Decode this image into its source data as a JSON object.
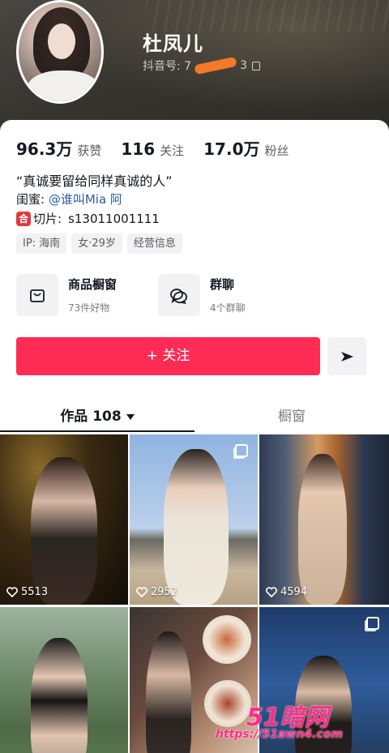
{
  "profile": {
    "name": "杜凤儿",
    "uid_label": "抖音号: 7",
    "uid_tail": "3"
  },
  "stats": [
    {
      "value": "96.3万",
      "label": "获赞"
    },
    {
      "value": "116",
      "label": "关注"
    },
    {
      "value": "17.0万",
      "label": "粉丝"
    }
  ],
  "bio": {
    "quote": "“真诚要留给同样真诚的人”",
    "friend_prefix": "闺蜜: ",
    "friend_link": "@谁叫Mia 阿",
    "clip_badge": "合",
    "clip_label": "切片:",
    "clip_value": "s13011001111"
  },
  "tags": [
    "IP: 海南",
    "女·29岁",
    "经营信息"
  ],
  "features": [
    {
      "title": "商品橱窗",
      "sub": "73件好物",
      "icon": "shop-bag-icon"
    },
    {
      "title": "群聊",
      "sub": "4个群聊",
      "icon": "chat-bubbles-icon"
    }
  ],
  "actions": {
    "follow_label": "+ 关注",
    "share_icon": "send-icon"
  },
  "tabs": [
    {
      "label": "作品 108",
      "active": true
    },
    {
      "label": "橱窗",
      "active": false
    }
  ],
  "posts": [
    {
      "likes": "5513",
      "multi": false
    },
    {
      "likes": "2952",
      "multi": true
    },
    {
      "likes": "4594",
      "multi": false
    },
    {
      "likes": "",
      "multi": false
    },
    {
      "likes": "",
      "multi": false
    },
    {
      "likes": "",
      "multi": true
    }
  ],
  "watermark": {
    "title": "51暗网",
    "url": "https://51awn4.com"
  },
  "colors": {
    "primary": "#fe2c55",
    "link": "#2d5b9e",
    "badge": "#e2383f"
  }
}
